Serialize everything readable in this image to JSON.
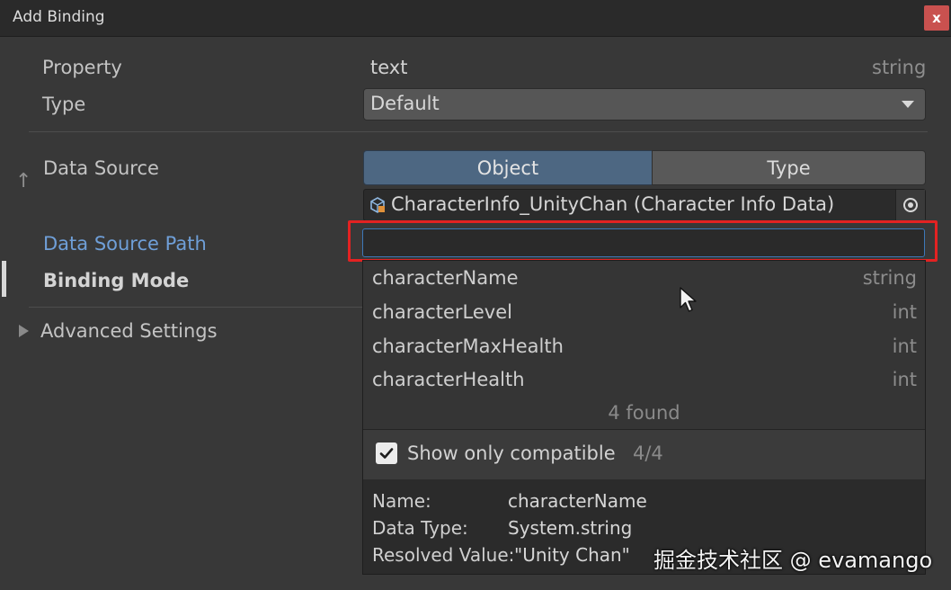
{
  "window": {
    "title": "Add Binding",
    "close_label": "x"
  },
  "fields": {
    "property_label": "Property",
    "property_value": "text",
    "property_type": "string",
    "type_label": "Type",
    "type_value": "Default",
    "data_source_label": "Data Source",
    "data_source_tabs": [
      "Object",
      "Type"
    ],
    "data_source_object": "CharacterInfo_UnityChan (Character Info Data)",
    "data_source_path_label": "Data Source Path",
    "data_source_path_value": "",
    "binding_mode_label": "Binding Mode",
    "advanced_settings_label": "Advanced Settings",
    "data_source_up_icon": "↑"
  },
  "path_popup": {
    "items": [
      {
        "name": "characterName",
        "type": "string"
      },
      {
        "name": "characterLevel",
        "type": "int"
      },
      {
        "name": "characterMaxHealth",
        "type": "int"
      },
      {
        "name": "characterHealth",
        "type": "int"
      }
    ],
    "found_text": "4 found",
    "show_compatible_label": "Show only compatible",
    "show_compatible_checked": true,
    "compatible_count": "4/4",
    "details": {
      "name_key": "Name:",
      "name_value": "characterName",
      "data_type_key": "Data Type:",
      "data_type_value": "System.string",
      "resolved_key": "Resolved Value:",
      "resolved_value": "\"Unity Chan\""
    }
  },
  "watermark": "掘金技术社区 @ evamango",
  "colors": {
    "background": "#383838",
    "selected_tab": "#4d6782",
    "label_accent": "#6f9fd8",
    "highlight": "#e32222",
    "close_button": "#c9514f"
  }
}
